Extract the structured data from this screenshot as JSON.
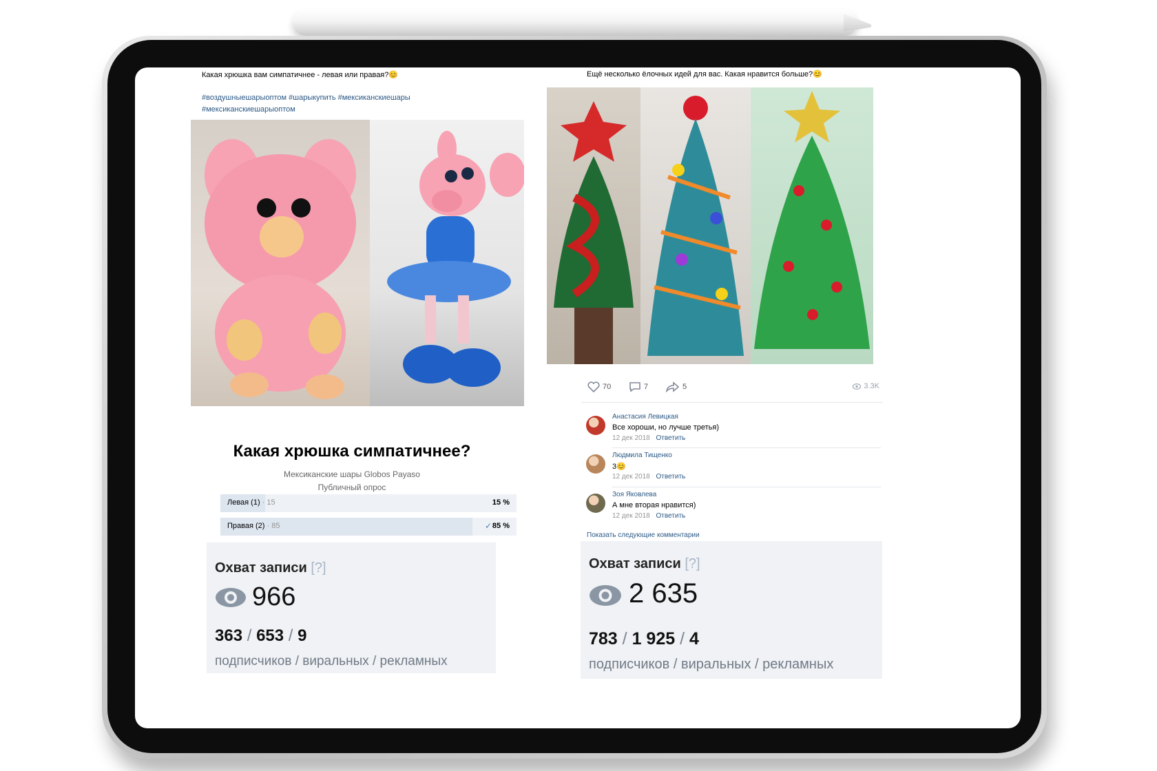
{
  "left_post": {
    "text": "Какая хрюшка вам симпатичнее - левая или правая?😊",
    "hashtags_line1": "#воздушныешарыоптом #шарыкупить #мексиканскиешары",
    "hashtags_line2": "#мексиканскиешарыоптом",
    "poll": {
      "title": "Какая хрюшка симпатичнее?",
      "author": "Мексиканские шары Globos Payaso",
      "type": "Публичный опрос",
      "options": [
        {
          "label": "Левая (1)",
          "count": "· 15",
          "percent_label": "15 %",
          "percent": 15,
          "voted": false
        },
        {
          "label": "Правая (2)",
          "count": "· 85",
          "percent_label": "85 %",
          "percent": 85,
          "voted": true
        }
      ]
    },
    "reach": {
      "title": "Охват записи",
      "help": "[?]",
      "total": "966",
      "subscribers": "363",
      "viral": "653",
      "ads": "9",
      "caption": "подписчиков / виральных / рекламных"
    }
  },
  "right_post": {
    "text": "Ещё несколько ёлочных идей для вас. Какая нравится больше?😊",
    "likes": "70",
    "comments_count": "7",
    "shares": "5",
    "views": "3.3K",
    "comments": [
      {
        "author": "Анастасия Левицкая",
        "text": "Все хороши, но лучше третья)",
        "date": "12 дек 2018",
        "reply": "Ответить",
        "avatar_color": "#c0392b"
      },
      {
        "author": "Людмила Тищенко",
        "text": "3😊",
        "date": "12 дек 2018",
        "reply": "Ответить",
        "avatar_color": "#b8865a"
      },
      {
        "author": "Зоя Яковлева",
        "text": "А мне вторая нравится)",
        "date": "12 дек 2018",
        "reply": "Ответить",
        "avatar_color": "#6f6a4e"
      }
    ],
    "show_more": "Показать следующие комментарии",
    "reach": {
      "title": "Охват записи",
      "help": "[?]",
      "total": "2 635",
      "subscribers": "783",
      "viral": "1 925",
      "ads": "4",
      "caption": "подписчиков / виральных / рекламных"
    }
  },
  "icons": {
    "like": "heart-icon",
    "comment": "comment-icon",
    "share": "share-icon",
    "views": "eye-icon"
  },
  "colors": {
    "link": "#2a5885",
    "poll_fill": "#dde5ef",
    "reach_bg": "#f0f2f5"
  }
}
